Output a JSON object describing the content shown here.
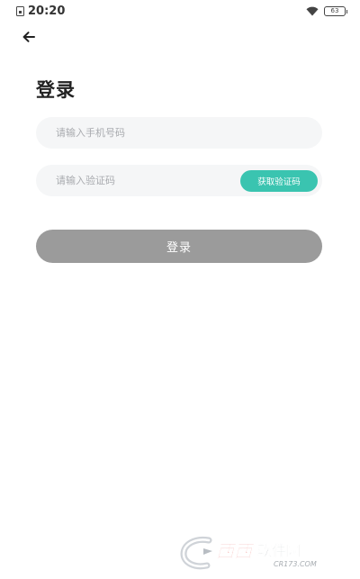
{
  "status_bar": {
    "time": "20:20",
    "sim_icon": "sim-card-icon",
    "wifi_icon": "wifi-icon",
    "battery_icon": "battery-icon",
    "battery_level": "63"
  },
  "header": {
    "back_icon": "back-arrow-icon"
  },
  "page": {
    "title": "登录"
  },
  "form": {
    "phone": {
      "placeholder": "请输入手机号码",
      "value": ""
    },
    "code": {
      "placeholder": "请输入验证码",
      "value": ""
    },
    "get_code_label": "获取验证码",
    "login_label": "登录"
  },
  "colors": {
    "accent": "#3ac4b0",
    "field_bg": "#f5f6f7",
    "login_button_bg": "#9b9b9b",
    "watermark_red": "#e8403c"
  },
  "watermark": {
    "text": "西西软件园",
    "sub_text": "CR173.COM"
  }
}
